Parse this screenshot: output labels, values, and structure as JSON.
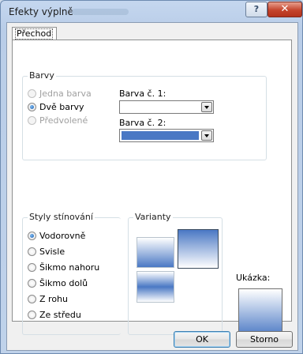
{
  "window": {
    "title": "Efekty výplně"
  },
  "titlebar": {
    "help_label": "?",
    "close_label": "✕"
  },
  "tabs": [
    {
      "label": "Přechod"
    }
  ],
  "colors_group": {
    "label": "Barvy",
    "options": [
      {
        "label": "Jedna barva",
        "checked": false,
        "disabled": true
      },
      {
        "label": "Dvě barvy",
        "checked": true,
        "disabled": false
      },
      {
        "label": "Předvolené",
        "checked": false,
        "disabled": true
      }
    ],
    "color1_label": "Barva č. 1:",
    "color2_label": "Barva č. 2:",
    "color1_value": "#ffffff",
    "color2_value": "#4a78c4"
  },
  "shading_group": {
    "label": "Styly stínování",
    "options": [
      {
        "label": "Vodorovně",
        "checked": true
      },
      {
        "label": "Svisle",
        "checked": false
      },
      {
        "label": "Šikmo nahoru",
        "checked": false
      },
      {
        "label": "Šikmo dolů",
        "checked": false
      },
      {
        "label": "Z rohu",
        "checked": false
      },
      {
        "label": "Ze středu",
        "checked": false
      }
    ]
  },
  "variants_group": {
    "label": "Varianty"
  },
  "sample": {
    "label": "Ukázka:"
  },
  "buttons": {
    "ok": "OK",
    "cancel": "Storno"
  }
}
